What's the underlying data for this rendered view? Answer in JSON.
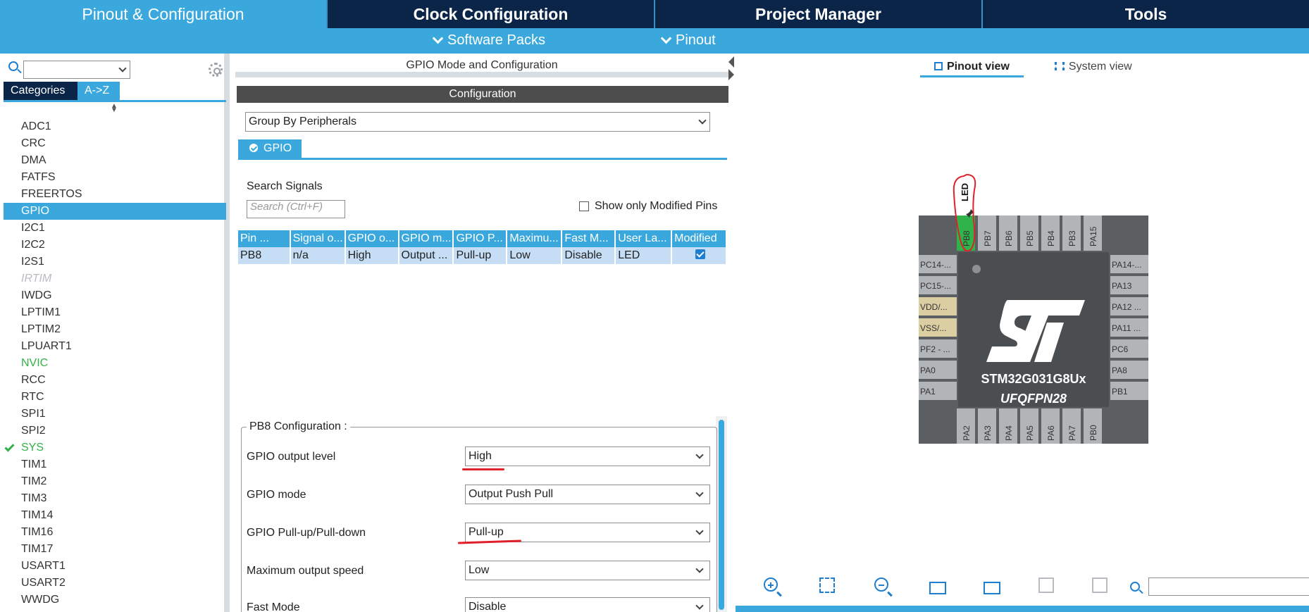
{
  "top_tabs": [
    "Pinout & Configuration",
    "Clock Configuration",
    "Project Manager",
    "Tools"
  ],
  "sub_tabs": [
    "Software Packs",
    "Pinout"
  ],
  "left": {
    "search_value": "",
    "cat_tab": "Categories",
    "az_tab": "A->Z",
    "peripherals": [
      "ADC1",
      "CRC",
      "DMA",
      "FATFS",
      "FREERTOS",
      "GPIO",
      "I2C1",
      "I2C2",
      "I2S1",
      "IRTIM",
      "IWDG",
      "LPTIM1",
      "LPTIM2",
      "LPUART1",
      "NVIC",
      "RCC",
      "RTC",
      "SPI1",
      "SPI2",
      "SYS",
      "TIM1",
      "TIM2",
      "TIM3",
      "TIM14",
      "TIM16",
      "TIM17",
      "USART1",
      "USART2",
      "WWDG"
    ],
    "selected": "GPIO"
  },
  "mid": {
    "header": "GPIO Mode and Configuration",
    "config_bar": "Configuration",
    "group_by": "Group By Peripherals",
    "gpio_tab": "GPIO",
    "search_signals_label": "Search Signals",
    "search_placeholder": "Search (Ctrl+F)",
    "modified_only_label": "Show only Modified Pins",
    "table_headers": [
      "Pin ...",
      "Signal o...",
      "GPIO o...",
      "GPIO m...",
      "GPIO P...",
      "Maximu...",
      "Fast M...",
      "User La...",
      "Modified"
    ],
    "table_row": [
      "PB8",
      "n/a",
      "High",
      "Output ...",
      "Pull-up",
      "Low",
      "Disable",
      "LED"
    ],
    "pb8_legend": "PB8 Configuration :",
    "config_rows": [
      {
        "label": "GPIO output level",
        "value": "High"
      },
      {
        "label": "GPIO mode",
        "value": "Output Push Pull"
      },
      {
        "label": "GPIO Pull-up/Pull-down",
        "value": "Pull-up"
      },
      {
        "label": "Maximum output speed",
        "value": "Low"
      },
      {
        "label": "Fast Mode",
        "value": "Disable"
      }
    ]
  },
  "right": {
    "pinout_view": "Pinout view",
    "system_view": "System view",
    "chip_name": "STM32G031G8Ux",
    "package": "UFQFPN28",
    "led_label": "LED",
    "top_pins": [
      "PB8",
      "PB7",
      "PB6",
      "PB5",
      "PB4",
      "PB3",
      "PA15"
    ],
    "bottom_pins": [
      "PA2",
      "PA3",
      "PA4",
      "PA5",
      "PA6",
      "PA7",
      "PB0"
    ],
    "left_pins": [
      "PC14-...",
      "PC15-...",
      "VDD/...",
      "VSS/...",
      "PF2 - ...",
      "PA0",
      "PA1"
    ],
    "right_pins": [
      "PA14-...",
      "PA13",
      "PA12 ...",
      "PA11 ...",
      "PC6",
      "PA8",
      "PB1"
    ],
    "search_value": ""
  },
  "colors": {
    "accent": "#3aa8dc",
    "navy": "#0b2549",
    "green": "#33b24a",
    "annotation": "#e0202a"
  }
}
